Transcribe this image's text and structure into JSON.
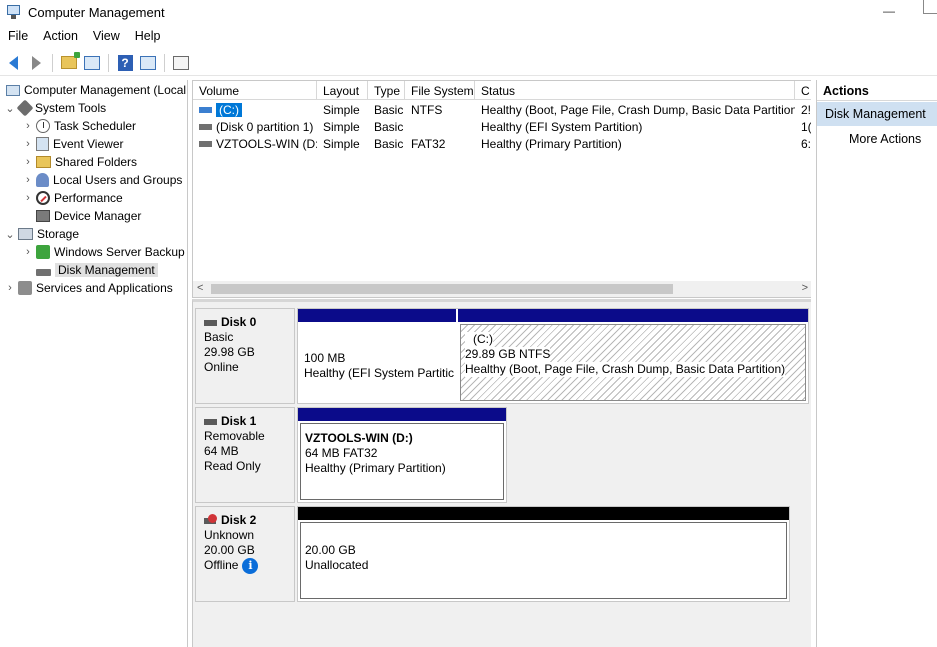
{
  "window": {
    "title": "Computer Management",
    "minimize_glyph": "—"
  },
  "menu": [
    "File",
    "Action",
    "View",
    "Help"
  ],
  "toolbar": {
    "icons": [
      "back-arrow-icon",
      "forward-arrow-icon",
      "up-folder-icon",
      "show-hide-console-tree-icon",
      "help-icon",
      "show-hide-action-pane-icon",
      "properties-icon"
    ],
    "help_glyph": "?"
  },
  "tree": {
    "root": "Computer Management (Local",
    "system_tools": "System Tools",
    "task_scheduler": "Task Scheduler",
    "event_viewer": "Event Viewer",
    "shared_folders": "Shared Folders",
    "local_users": "Local Users and Groups",
    "performance": "Performance",
    "device_manager": "Device Manager",
    "storage": "Storage",
    "windows_backup": "Windows Server Backup",
    "disk_management": "Disk Management",
    "services": "Services and Applications",
    "expand_glyph": "›",
    "collapse_glyph": "⌄"
  },
  "volume_list": {
    "columns": [
      "Volume",
      "Layout",
      "Type",
      "File System",
      "Status",
      "C"
    ],
    "rows": [
      {
        "volume": "(C:)",
        "layout": "Simple",
        "type": "Basic",
        "fs": "NTFS",
        "status": "Healthy (Boot, Page File, Crash Dump, Basic Data Partition)",
        "cap": "2!"
      },
      {
        "volume": "(Disk 0 partition 1)",
        "layout": "Simple",
        "type": "Basic",
        "fs": "",
        "status": "Healthy (EFI System Partition)",
        "cap": "1("
      },
      {
        "volume": "VZTOOLS-WIN (D:)",
        "layout": "Simple",
        "type": "Basic",
        "fs": "FAT32",
        "status": "Healthy (Primary Partition)",
        "cap": "6:"
      }
    ],
    "scroll_left": "<",
    "scroll_right": ">"
  },
  "disks": [
    {
      "name": "Disk 0",
      "type": "Basic",
      "size": "29.98 GB",
      "state": "Online",
      "partitions": [
        {
          "label": "",
          "size": "100 MB",
          "status": "Healthy (EFI System Partitic"
        },
        {
          "label": "(C:)",
          "size": "29.89 GB NTFS",
          "status": "Healthy (Boot, Page File, Crash Dump, Basic Data Partition)"
        }
      ]
    },
    {
      "name": "Disk 1",
      "type": "Removable",
      "size": "64 MB",
      "state": "Read Only",
      "partitions": [
        {
          "label": "VZTOOLS-WIN  (D:)",
          "size": "64 MB FAT32",
          "status": "Healthy (Primary Partition)"
        }
      ]
    },
    {
      "name": "Disk 2",
      "type": "Unknown",
      "size": "20.00 GB",
      "state": "Offline",
      "info_glyph": "i",
      "partitions": [
        {
          "label": "",
          "size": "20.00 GB",
          "status": "Unallocated"
        }
      ]
    }
  ],
  "actions": {
    "header": "Actions",
    "section": "Disk Management",
    "more": "More Actions",
    "more_glyph": "▸"
  },
  "colors": {
    "selection": "#0078d7",
    "partition_bar": "#0b0b8a",
    "unallocated_bar": "#000000",
    "actions_section_bg": "#cfe0f1"
  }
}
